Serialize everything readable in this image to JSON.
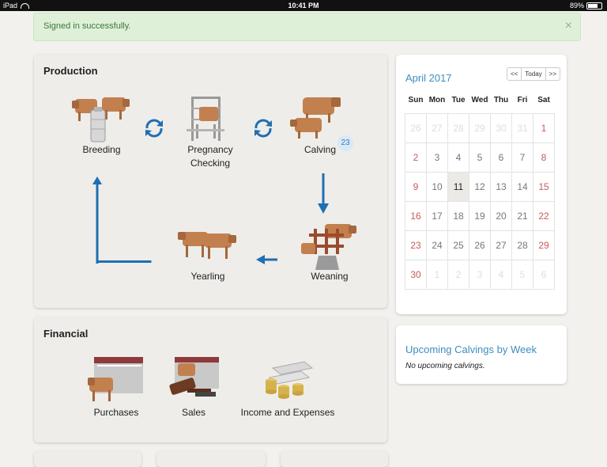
{
  "status_bar": {
    "device": "iPad",
    "time": "10:41 PM",
    "battery": "89%",
    "battery_level": 0.89
  },
  "alert": {
    "message": "Signed in successfully.",
    "close": "×"
  },
  "production": {
    "title": "Production",
    "breeding": "Breeding",
    "pregnancy_line1": "Pregnancy",
    "pregnancy_line2": "Checking",
    "calving": "Calving",
    "calving_count": "23",
    "weaning": "Weaning",
    "yearling": "Yearling"
  },
  "financial": {
    "title": "Financial",
    "purchases": "Purchases",
    "sales": "Sales",
    "income": "Income and Expenses"
  },
  "calendar": {
    "month": "April 2017",
    "prev": "<<",
    "today": "Today",
    "next": ">>",
    "weekdays": [
      "Sun",
      "Mon",
      "Tue",
      "Wed",
      "Thu",
      "Fri",
      "Sat"
    ],
    "weeks": [
      [
        "26",
        "27",
        "28",
        "29",
        "30",
        "31",
        "1"
      ],
      [
        "2",
        "3",
        "4",
        "5",
        "6",
        "7",
        "8"
      ],
      [
        "9",
        "10",
        "11",
        "12",
        "13",
        "14",
        "15"
      ],
      [
        "16",
        "17",
        "18",
        "19",
        "20",
        "21",
        "22"
      ],
      [
        "23",
        "24",
        "25",
        "26",
        "27",
        "28",
        "29"
      ],
      [
        "30",
        "1",
        "2",
        "3",
        "4",
        "5",
        "6"
      ]
    ],
    "today_date": "11"
  },
  "upcoming": {
    "title": "Upcoming Calvings by Week",
    "empty": "No upcoming calvings."
  },
  "colors": {
    "accent": "#3d8dbf",
    "arrow": "#1f6fb2",
    "weekend": "#c85b5b",
    "alert_bg": "#dff0d8",
    "alert_text": "#3c763d",
    "cattle": "#c2804f"
  }
}
